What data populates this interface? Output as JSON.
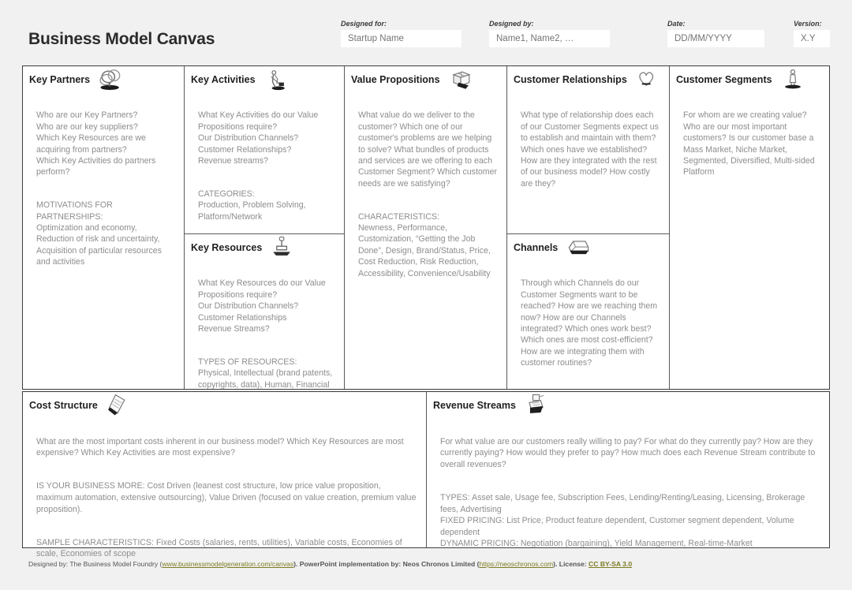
{
  "header": {
    "title": "Business Model Canvas",
    "fields": [
      {
        "label": "Designed for:",
        "value": "Startup Name",
        "placeholder": "Startup Name"
      },
      {
        "label": "Designed by:",
        "value": "Name1, Name2, …",
        "placeholder": "Name1, Name2, …"
      },
      {
        "label": "Date:",
        "value": "DD/MM/YYYY",
        "placeholder": "DD/MM/YYYY"
      },
      {
        "label": "Version:",
        "value": "X.Y",
        "placeholder": "X.Y"
      }
    ]
  },
  "blocks": {
    "key_partners": {
      "title": "Key Partners",
      "icon": "chain-links-icon",
      "body": "Who are our Key Partners?\nWho are our key suppliers?\nWhich Key Resources are we acquiring from partners?\nWhich Key Activities do partners perform?",
      "body2": "MOTIVATIONS FOR PARTNERSHIPS:\nOptimization and economy, Reduction of risk and uncertainty, Acquisition of particular resources and activities"
    },
    "key_activities": {
      "title": "Key Activities",
      "icon": "worker-hammer-icon",
      "body": "What Key Activities do our Value Propositions require?\nOur Distribution Channels?\nCustomer Relationships?\nRevenue streams?",
      "body2": "CATEGORIES:\nProduction, Problem Solving, Platform/Network"
    },
    "key_resources": {
      "title": "Key Resources",
      "icon": "stamp-press-icon",
      "body": "What Key Resources do our Value Propositions require?\nOur Distribution Channels?\nCustomer Relationships\nRevenue Streams?",
      "body2": "TYPES OF RESOURCES:\nPhysical, Intellectual (brand patents, copyrights, data), Human, Financial"
    },
    "value_propositions": {
      "title": "Value Propositions",
      "icon": "gift-box-icon",
      "body": "What value do we deliver to the customer? Which one of our customer's problems are we helping to solve? What bundles of products and services are we offering to each Customer Segment? Which customer needs are we satisfying?",
      "body2": "CHARACTERISTICS:\nNewness, Performance, Customization, “Getting the Job Done”, Design, Brand/Status, Price, Cost Reduction, Risk Reduction, Accessibility, Convenience/Usability"
    },
    "customer_relationships": {
      "title": "Customer Relationships",
      "icon": "heart-icon",
      "body": "What type of relationship does each of our Customer Segments expect us to establish and maintain with them? Which ones have we established? How are they integrated with the rest of our business model? How costly are they?"
    },
    "channels": {
      "title": "Channels",
      "icon": "truck-icon",
      "body": "Through which Channels do our Customer Segments want to be reached? How are we reaching them now? How are our Channels integrated? Which ones work best? Which ones are most cost-efficient? How are we integrating them with customer routines?"
    },
    "customer_segments": {
      "title": "Customer Segments",
      "icon": "person-icon",
      "body": "For whom are we creating value? Who are our most important customers? Is our customer base a Mass Market, Niche Market, Segmented, Diversified, Multi-sided Platform"
    },
    "cost_structure": {
      "title": "Cost Structure",
      "icon": "price-tag-icon",
      "body": "What are the most important costs inherent in our business model? Which Key Resources are most expensive? Which Key Activities are most expensive?",
      "body2": "IS YOUR BUSINESS MORE: Cost Driven (leanest cost structure, low price value proposition, maximum automation, extensive outsourcing), Value Driven (focused on value creation, premium value proposition).",
      "body3": "SAMPLE CHARACTERISTICS: Fixed Costs (salaries, rents, utilities), Variable costs, Economies of scale, Economies of scope"
    },
    "revenue_streams": {
      "title": "Revenue Streams",
      "icon": "cash-register-icon",
      "body": "For what value are our customers really willing to pay? For what do they currently pay? How are they currently paying? How would they prefer to pay? How much does each Revenue Stream contribute to overall revenues?",
      "body2": "TYPES: Asset sale, Usage fee, Subscription Fees, Lending/Renting/Leasing, Licensing, Brokerage fees, Advertising\nFIXED PRICING: List Price, Product feature dependent, Customer segment dependent, Volume dependent\nDYNAMIC PRICING: Negotiation (bargaining), Yield Management, Real-time-Market"
    }
  },
  "footer": {
    "part1": "Designed by: The Business Model Foundry (",
    "link1": "www.businessmodelgeneration.com/canvas",
    "part2": "). PowerPoint implementation by: Neos Chronos Limited (",
    "link2": "https://neoschronos.com",
    "part3": "). License: ",
    "link3": "CC BY-SA 3.0"
  },
  "colors": {
    "page_background": "#f1f1f1",
    "canvas_background": "#ffffff",
    "outer_border": "#3d3d3d",
    "inner_border": "#5a5a5a",
    "title_text": "#2b2b2b",
    "body_text": "#8d8d8d",
    "link": "#7d7a22"
  }
}
